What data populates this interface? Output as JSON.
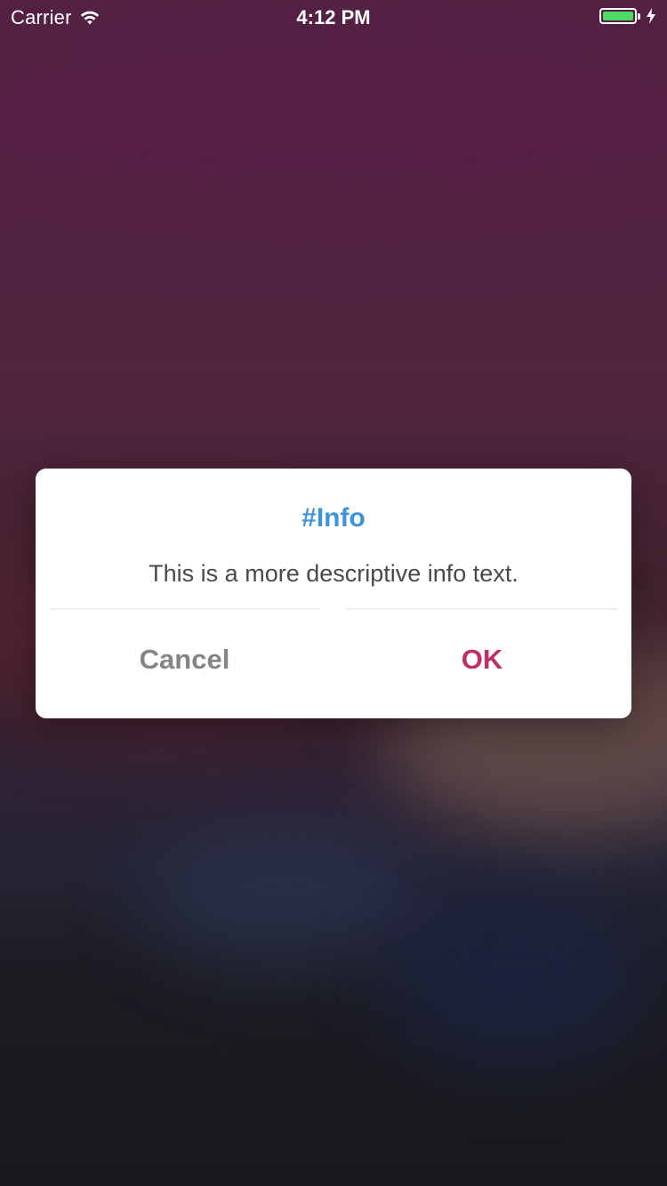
{
  "status_bar": {
    "carrier": "Carrier",
    "time": "4:12 PM",
    "wifi_icon": "wifi-icon",
    "battery_icon": "battery-icon",
    "charging_icon": "lightning-bolt-icon",
    "battery_level": 1.0,
    "battery_color": "#4cd964"
  },
  "alert": {
    "title": "#Info",
    "message": "This is a more descriptive info text.",
    "cancel_label": "Cancel",
    "ok_label": "OK",
    "title_color": "#3f93d9",
    "ok_color": "#c12e67",
    "cancel_color": "#858585"
  }
}
